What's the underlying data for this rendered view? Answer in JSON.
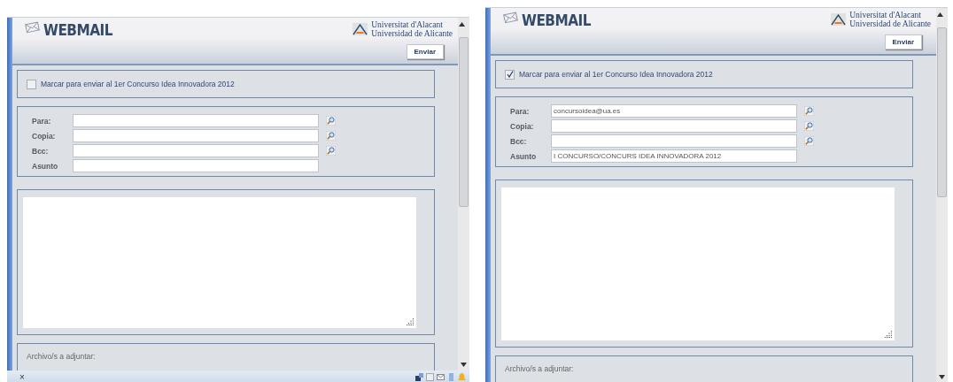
{
  "panels": [
    {
      "brand": "WEBMAIL",
      "university": [
        "Universitat d'Alacant",
        "Universidad de Alicante"
      ],
      "send_button": "Enviar",
      "contest": {
        "label": "Marcar para enviar al 1er Concurso Idea Innovadora 2012",
        "checked": false
      },
      "fields": [
        {
          "label": "Para:",
          "kind": "address"
        },
        {
          "label": "Copia:",
          "kind": "address"
        },
        {
          "label": "Bcc:",
          "kind": "address"
        },
        {
          "label": "Asunto",
          "kind": "subject"
        }
      ],
      "attachments_label": "Archivo/s a adjuntar:",
      "status_bar": {
        "close": "×"
      }
    },
    {
      "brand": "WEBMAIL",
      "university": [
        "Universitat d'Alacant",
        "Universidad de Alicante"
      ],
      "send_button": "Enviar",
      "contest": {
        "label": "Marcar para enviar al 1er Concurso Idea Innovadora 2012",
        "checked": true
      },
      "fields": [
        {
          "label": "Para:",
          "value": "concursoidea@ua.es",
          "kind": "address"
        },
        {
          "label": "Copia:",
          "kind": "address"
        },
        {
          "label": "Bcc:",
          "kind": "address"
        },
        {
          "label": "Asunto",
          "value": "I CONCURSO/CONCURS IDEA INNOVADORA 2012",
          "kind": "subject"
        }
      ],
      "attachments_label": "Archivo/s a adjuntar:"
    }
  ]
}
